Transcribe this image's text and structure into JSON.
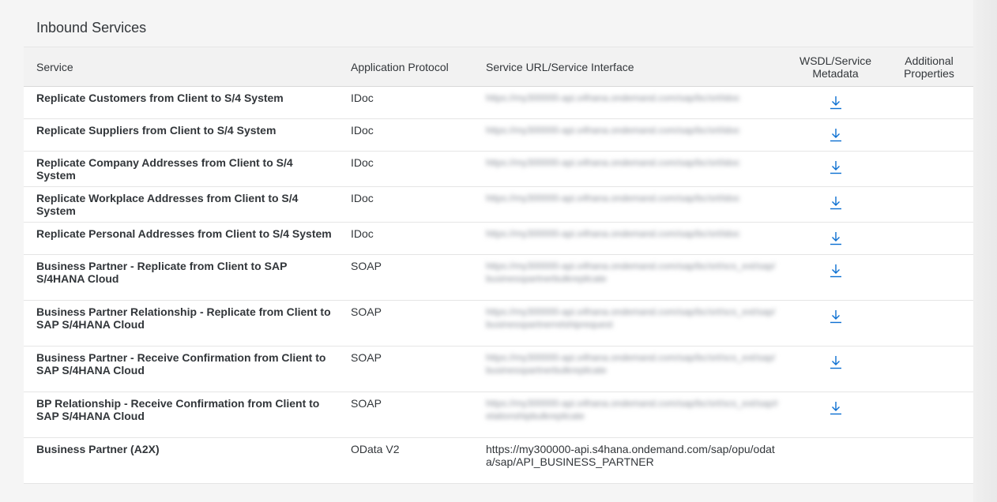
{
  "section": {
    "title": "Inbound Services"
  },
  "columns": {
    "service": "Service",
    "protocol": "Application Protocol",
    "url": "Service URL/Service Interface",
    "wsdl": "WSDL/Service Metadata",
    "props": "Additional Properties"
  },
  "rows": [
    {
      "service": "Replicate Customers from Client to S/4 System",
      "protocol": "IDoc",
      "url": "https://my300000-api.s4hana.ondemand.com/sap/bc/srt/idoc",
      "url_blurred": true,
      "wsdl_icon": "download-icon"
    },
    {
      "service": "Replicate Suppliers from Client to S/4 System",
      "protocol": "IDoc",
      "url": "https://my300000-api.s4hana.ondemand.com/sap/bc/srt/idoc",
      "url_blurred": true,
      "wsdl_icon": "download-icon"
    },
    {
      "service": "Replicate Company Addresses from Client to S/4 System",
      "protocol": "IDoc",
      "url": "https://my300000-api.s4hana.ondemand.com/sap/bc/srt/idoc",
      "url_blurred": true,
      "wsdl_icon": "download-icon"
    },
    {
      "service": "Replicate Workplace Addresses from Client to S/4 System",
      "protocol": "IDoc",
      "url": "https://my300000-api.s4hana.ondemand.com/sap/bc/srt/idoc",
      "url_blurred": true,
      "wsdl_icon": "download-icon"
    },
    {
      "service": "Replicate Personal Addresses from Client to S/4 System",
      "protocol": "IDoc",
      "url": "https://my300000-api.s4hana.ondemand.com/sap/bc/srt/idoc",
      "url_blurred": true,
      "wsdl_icon": "download-icon"
    },
    {
      "service": "Business Partner - Replicate from Client to SAP S/4HANA Cloud",
      "protocol": "SOAP",
      "url": "https://my300000-api.s4hana.ondemand.com/sap/bc/srt/scs_ext/sap/businesspartnerbulkreplicate",
      "url_blurred": true,
      "wsdl_icon": "download-icon"
    },
    {
      "service": "Business Partner Relationship - Replicate from Client to SAP S/4HANA Cloud",
      "protocol": "SOAP",
      "url": "https://my300000-api.s4hana.ondemand.com/sap/bc/srt/scs_ext/sap/businesspartnerrelshiprequest",
      "url_blurred": true,
      "wsdl_icon": "download-icon"
    },
    {
      "service": "Business Partner - Receive Confirmation from Client to SAP S/4HANA Cloud",
      "protocol": "SOAP",
      "url": "https://my300000-api.s4hana.ondemand.com/sap/bc/srt/scs_ext/sap/businesspartnerbulkreplicate",
      "url_blurred": true,
      "wsdl_icon": "download-icon"
    },
    {
      "service": "BP Relationship - Receive Confirmation from Client to SAP S/4HANA Cloud",
      "protocol": "SOAP",
      "url": "https://my300000-api.s4hana.ondemand.com/sap/bc/srt/scs_ext/sap/relationshipbulkreplicate",
      "url_blurred": true,
      "wsdl_icon": "download-icon"
    },
    {
      "service": "Business Partner (A2X)",
      "protocol": "OData V2",
      "url": "https://my300000-api.s4hana.ondemand.com/sap/opu/odata/sap/API_BUSINESS_PARTNER",
      "url_blurred": false,
      "wsdl_icon": ""
    }
  ],
  "colors": {
    "link": "#0a6ed1",
    "text": "#32363a",
    "header_bg": "#f2f2f2"
  }
}
